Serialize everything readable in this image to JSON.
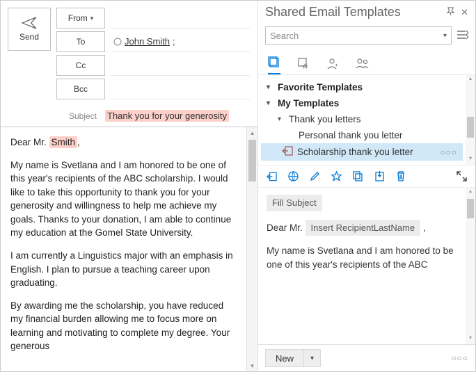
{
  "compose": {
    "send_label": "Send",
    "from_label": "From",
    "to_label": "To",
    "cc_label": "Cc",
    "bcc_label": "Bcc",
    "subject_label": "Subject",
    "to_value": "John Smith",
    "to_suffix": ";",
    "subject_value": "Thank you for your generosity",
    "body_greeting_pre": "Dear Mr. ",
    "body_greeting_name": "Smith",
    "body_greeting_post": ",",
    "body_p1": "My name is Svetlana and I am honored to be one of this year's recipients of the ABC scholarship. I would like to take this opportunity to thank you for your generosity and willingness to help me achieve my goals. Thanks to your donation, I am able to continue my education at the Gomel State University.",
    "body_p2": "I am currently a Linguistics major with an emphasis in English. I plan to pursue a teaching career upon graduating.",
    "body_p3": "By awarding me the scholarship, you have reduced my financial burden allowing me to focus more on learning and motivating to complete my degree. Your generous"
  },
  "panel": {
    "title": "Shared Email Templates",
    "search_placeholder": "Search",
    "groups": {
      "favorite": "Favorite Templates",
      "my": "My Templates",
      "thanks": "Thank you letters",
      "personal": "Personal thank you letter",
      "scholarship": "Scholarship thank you letter"
    },
    "preview": {
      "fill_subject": "Fill Subject",
      "greeting_pre": "Dear Mr.",
      "insert_token": "Insert RecipientLastName",
      "greeting_post": ",",
      "body": "My name is Svetlana and I am honored to be one of this year's recipients of the ABC"
    },
    "new_label": "New"
  }
}
